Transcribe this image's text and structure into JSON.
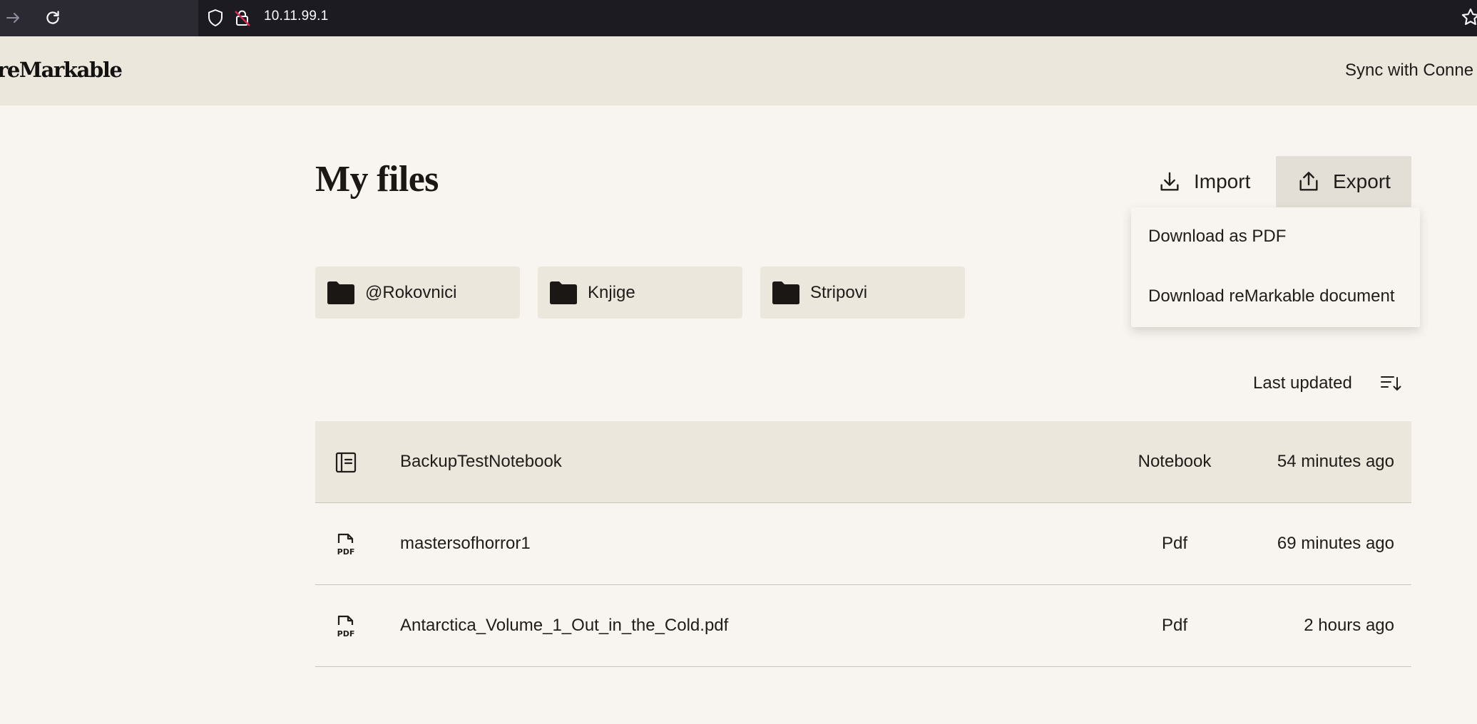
{
  "browser": {
    "url": "10.11.99.1",
    "icons": [
      "back-arrow-icon",
      "forward-arrow-icon",
      "reload-icon",
      "shield-icon",
      "insecure-lock-icon",
      "bookmark-star-icon"
    ]
  },
  "header": {
    "logo": "reMarkable",
    "sync_label": "Sync with Conne"
  },
  "main": {
    "title": "My files",
    "import_label": "Import",
    "export_label": "Export",
    "export_menu": {
      "items": [
        "Download as PDF",
        "Download reMarkable document"
      ]
    },
    "folders": [
      {
        "name": "@Rokovnici"
      },
      {
        "name": "Knjige"
      },
      {
        "name": "Stripovi"
      }
    ],
    "sort": {
      "label": "Last updated"
    },
    "files": [
      {
        "name": "BackupTestNotebook",
        "type": "Notebook",
        "updated": "54 minutes ago",
        "icon": "notebook-icon",
        "selected": true
      },
      {
        "name": "mastersofhorror1",
        "type": "Pdf",
        "updated": "69 minutes ago",
        "icon": "pdf-icon",
        "selected": false
      },
      {
        "name": "Antarctica_Volume_1_Out_in_the_Cold.pdf",
        "type": "Pdf",
        "updated": "2 hours ago",
        "icon": "pdf-icon",
        "selected": false
      }
    ]
  },
  "colors": {
    "page_bg": "#f8f5f0",
    "header_bg": "#ebe7dd",
    "export_bg": "#e3dfd7",
    "text": "#1f1c19"
  }
}
